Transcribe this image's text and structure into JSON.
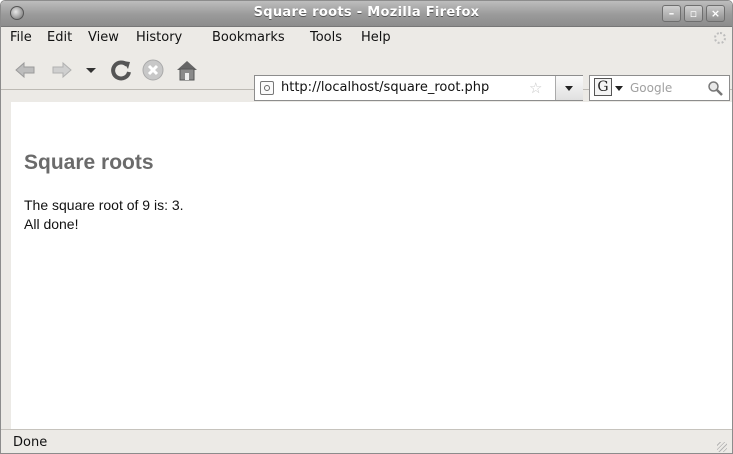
{
  "window": {
    "title": "Square roots - Mozilla Firefox"
  },
  "menu": {
    "file": "File",
    "edit": "Edit",
    "view": "View",
    "history": "History",
    "bookmarks": "Bookmarks",
    "tools": "Tools",
    "help": "Help"
  },
  "toolbar": {
    "url": "http://localhost/square_root.php",
    "search_placeholder": "Google",
    "search_engine_letter": "G"
  },
  "page": {
    "heading": "Square roots",
    "line1": "The square root of 9 is: 3.",
    "line2": "All done!"
  },
  "status": {
    "text": "Done"
  },
  "icons": {
    "app": "firefox-icon",
    "back": "back-arrow-icon",
    "forward": "forward-arrow-icon",
    "history_dropdown": "chevron-down-icon",
    "reload": "reload-icon",
    "stop": "stop-icon",
    "home": "home-icon",
    "bookmark_star": "star-icon",
    "search": "magnifier-icon"
  },
  "colors": {
    "heading": "#6b6b6b",
    "titlebar": "#9a9a9a",
    "chrome": "#eceae6"
  }
}
